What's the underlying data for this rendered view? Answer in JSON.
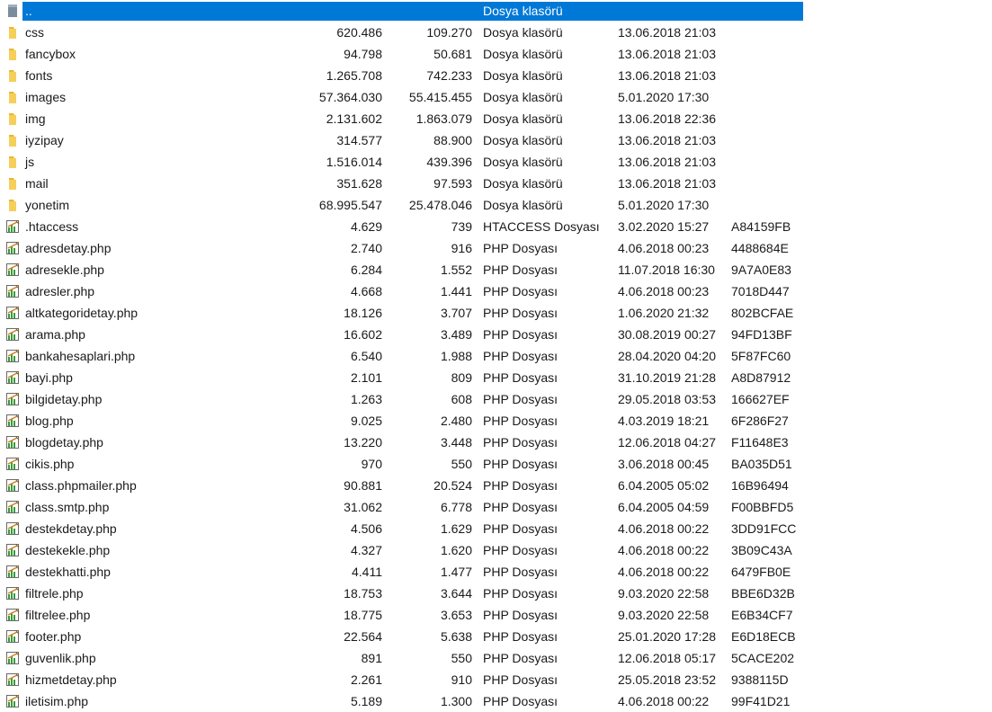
{
  "parent": {
    "name": "..",
    "type": "Dosya klasörü"
  },
  "rows": [
    {
      "kind": "folder",
      "name": "css",
      "size": "620.486",
      "packed": "109.270",
      "type": "Dosya klasörü",
      "modified": "13.06.2018 21:03",
      "crc": ""
    },
    {
      "kind": "folder",
      "name": "fancybox",
      "size": "94.798",
      "packed": "50.681",
      "type": "Dosya klasörü",
      "modified": "13.06.2018 21:03",
      "crc": ""
    },
    {
      "kind": "folder",
      "name": "fonts",
      "size": "1.265.708",
      "packed": "742.233",
      "type": "Dosya klasörü",
      "modified": "13.06.2018 21:03",
      "crc": ""
    },
    {
      "kind": "folder",
      "name": "images",
      "size": "57.364.030",
      "packed": "55.415.455",
      "type": "Dosya klasörü",
      "modified": "5.01.2020 17:30",
      "crc": ""
    },
    {
      "kind": "folder",
      "name": "img",
      "size": "2.131.602",
      "packed": "1.863.079",
      "type": "Dosya klasörü",
      "modified": "13.06.2018 22:36",
      "crc": ""
    },
    {
      "kind": "folder",
      "name": "iyzipay",
      "size": "314.577",
      "packed": "88.900",
      "type": "Dosya klasörü",
      "modified": "13.06.2018 21:03",
      "crc": ""
    },
    {
      "kind": "folder",
      "name": "js",
      "size": "1.516.014",
      "packed": "439.396",
      "type": "Dosya klasörü",
      "modified": "13.06.2018 21:03",
      "crc": ""
    },
    {
      "kind": "folder",
      "name": "mail",
      "size": "351.628",
      "packed": "97.593",
      "type": "Dosya klasörü",
      "modified": "13.06.2018 21:03",
      "crc": ""
    },
    {
      "kind": "folder",
      "name": "yonetim",
      "size": "68.995.547",
      "packed": "25.478.046",
      "type": "Dosya klasörü",
      "modified": "5.01.2020 17:30",
      "crc": ""
    },
    {
      "kind": "file",
      "name": ".htaccess",
      "size": "4.629",
      "packed": "739",
      "type": "HTACCESS Dosyası",
      "modified": "3.02.2020 15:27",
      "crc": "A84159FB"
    },
    {
      "kind": "file",
      "name": "adresdetay.php",
      "size": "2.740",
      "packed": "916",
      "type": "PHP Dosyası",
      "modified": "4.06.2018 00:23",
      "crc": "4488684E"
    },
    {
      "kind": "file",
      "name": "adresekle.php",
      "size": "6.284",
      "packed": "1.552",
      "type": "PHP Dosyası",
      "modified": "11.07.2018 16:30",
      "crc": "9A7A0E83"
    },
    {
      "kind": "file",
      "name": "adresler.php",
      "size": "4.668",
      "packed": "1.441",
      "type": "PHP Dosyası",
      "modified": "4.06.2018 00:23",
      "crc": "7018D447"
    },
    {
      "kind": "file",
      "name": "altkategoridetay.php",
      "size": "18.126",
      "packed": "3.707",
      "type": "PHP Dosyası",
      "modified": "1.06.2020 21:32",
      "crc": "802BCFAE"
    },
    {
      "kind": "file",
      "name": "arama.php",
      "size": "16.602",
      "packed": "3.489",
      "type": "PHP Dosyası",
      "modified": "30.08.2019 00:27",
      "crc": "94FD13BF"
    },
    {
      "kind": "file",
      "name": "bankahesaplari.php",
      "size": "6.540",
      "packed": "1.988",
      "type": "PHP Dosyası",
      "modified": "28.04.2020 04:20",
      "crc": "5F87FC60"
    },
    {
      "kind": "file",
      "name": "bayi.php",
      "size": "2.101",
      "packed": "809",
      "type": "PHP Dosyası",
      "modified": "31.10.2019 21:28",
      "crc": "A8D87912"
    },
    {
      "kind": "file",
      "name": "bilgidetay.php",
      "size": "1.263",
      "packed": "608",
      "type": "PHP Dosyası",
      "modified": "29.05.2018 03:53",
      "crc": "166627EF"
    },
    {
      "kind": "file",
      "name": "blog.php",
      "size": "9.025",
      "packed": "2.480",
      "type": "PHP Dosyası",
      "modified": "4.03.2019 18:21",
      "crc": "6F286F27"
    },
    {
      "kind": "file",
      "name": "blogdetay.php",
      "size": "13.220",
      "packed": "3.448",
      "type": "PHP Dosyası",
      "modified": "12.06.2018 04:27",
      "crc": "F11648E3"
    },
    {
      "kind": "file",
      "name": "cikis.php",
      "size": "970",
      "packed": "550",
      "type": "PHP Dosyası",
      "modified": "3.06.2018 00:45",
      "crc": "BA035D51"
    },
    {
      "kind": "file",
      "name": "class.phpmailer.php",
      "size": "90.881",
      "packed": "20.524",
      "type": "PHP Dosyası",
      "modified": "6.04.2005 05:02",
      "crc": "16B96494"
    },
    {
      "kind": "file",
      "name": "class.smtp.php",
      "size": "31.062",
      "packed": "6.778",
      "type": "PHP Dosyası",
      "modified": "6.04.2005 04:59",
      "crc": "F00BBFD5"
    },
    {
      "kind": "file",
      "name": "destekdetay.php",
      "size": "4.506",
      "packed": "1.629",
      "type": "PHP Dosyası",
      "modified": "4.06.2018 00:22",
      "crc": "3DD91FCC"
    },
    {
      "kind": "file",
      "name": "destekekle.php",
      "size": "4.327",
      "packed": "1.620",
      "type": "PHP Dosyası",
      "modified": "4.06.2018 00:22",
      "crc": "3B09C43A"
    },
    {
      "kind": "file",
      "name": "destekhatti.php",
      "size": "4.411",
      "packed": "1.477",
      "type": "PHP Dosyası",
      "modified": "4.06.2018 00:22",
      "crc": "6479FB0E"
    },
    {
      "kind": "file",
      "name": "filtrele.php",
      "size": "18.753",
      "packed": "3.644",
      "type": "PHP Dosyası",
      "modified": "9.03.2020 22:58",
      "crc": "BBE6D32B"
    },
    {
      "kind": "file",
      "name": "filtrelee.php",
      "size": "18.775",
      "packed": "3.653",
      "type": "PHP Dosyası",
      "modified": "9.03.2020 22:58",
      "crc": "E6B34CF7"
    },
    {
      "kind": "file",
      "name": "footer.php",
      "size": "22.564",
      "packed": "5.638",
      "type": "PHP Dosyası",
      "modified": "25.01.2020 17:28",
      "crc": "E6D18ECB"
    },
    {
      "kind": "file",
      "name": "guvenlik.php",
      "size": "891",
      "packed": "550",
      "type": "PHP Dosyası",
      "modified": "12.06.2018 05:17",
      "crc": "5CACE202"
    },
    {
      "kind": "file",
      "name": "hizmetdetay.php",
      "size": "2.261",
      "packed": "910",
      "type": "PHP Dosyası",
      "modified": "25.05.2018 23:52",
      "crc": "9388115D"
    },
    {
      "kind": "file",
      "name": "iletisim.php",
      "size": "5.189",
      "packed": "1.300",
      "type": "PHP Dosyası",
      "modified": "4.06.2018 00:22",
      "crc": "99F41D21"
    }
  ],
  "icons": {
    "folder": "folder-icon",
    "file": "php-file-icon",
    "up": "parent-folder-icon"
  },
  "colors": {
    "selection": "#0078d7",
    "folder": "#f0c040",
    "file_bar": "#3a9a3a"
  }
}
